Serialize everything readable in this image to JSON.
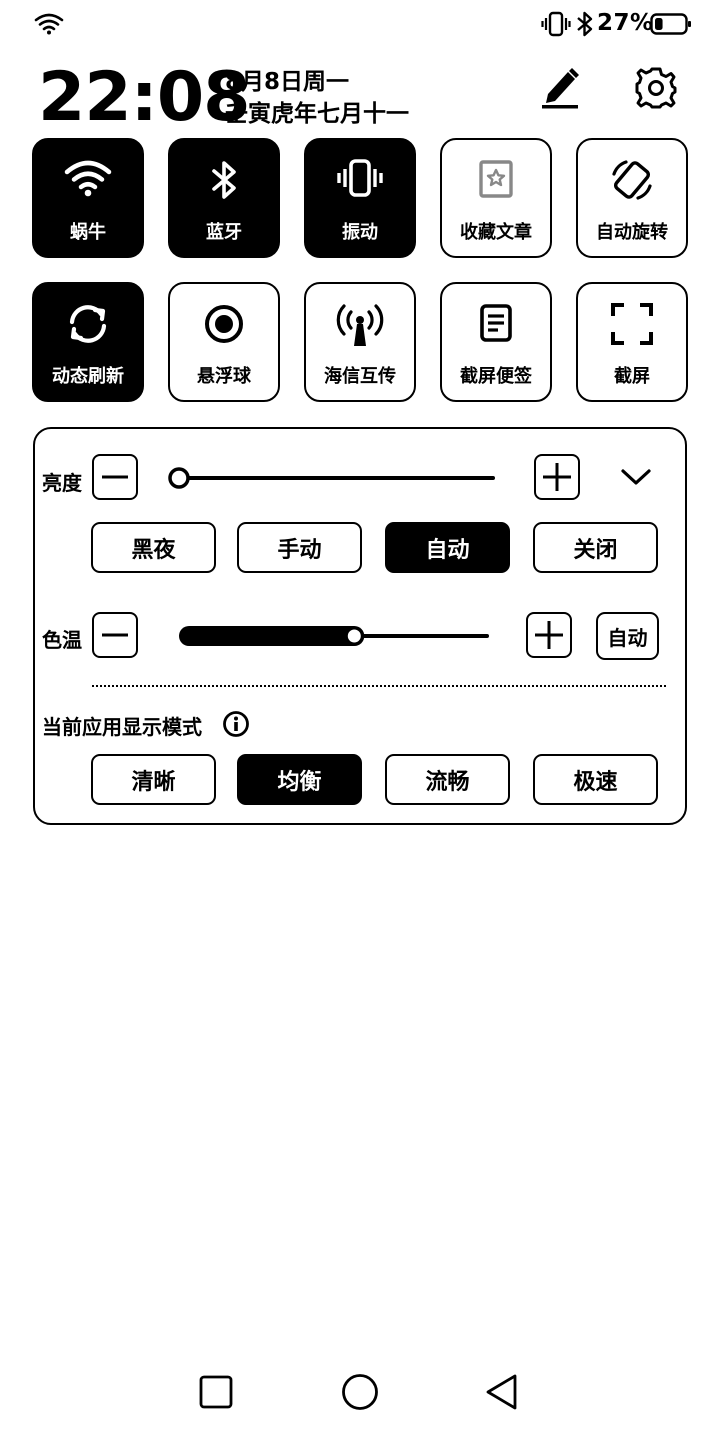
{
  "status_bar": {
    "battery_percent": "27%",
    "battery_level": 0.27,
    "icons": [
      "wifi-icon",
      "vibrate-icon",
      "bluetooth-icon",
      "battery-icon"
    ]
  },
  "header": {
    "time": "22:08",
    "date": "8月8日周一",
    "lunar_date": "壬寅虎年七月十一",
    "icons": [
      "edit-icon",
      "settings-icon"
    ]
  },
  "tiles": [
    {
      "label": "蜗牛",
      "icon": "wifi-icon",
      "active": true
    },
    {
      "label": "蓝牙",
      "icon": "bluetooth-icon",
      "active": true
    },
    {
      "label": "振动",
      "icon": "vibrate-icon",
      "active": true
    },
    {
      "label": "收藏文章",
      "icon": "bookmark-star-icon",
      "active": false
    },
    {
      "label": "自动旋转",
      "icon": "auto-rotate-icon",
      "active": false
    },
    {
      "label": "动态刷新",
      "icon": "refresh-icon",
      "active": true
    },
    {
      "label": "悬浮球",
      "icon": "floating-ball-icon",
      "active": false
    },
    {
      "label": "海信互传",
      "icon": "antenna-icon",
      "active": false
    },
    {
      "label": "截屏便签",
      "icon": "note-icon",
      "active": false
    },
    {
      "label": "截屏",
      "icon": "screenshot-icon",
      "active": false
    }
  ],
  "brightness": {
    "label": "亮度",
    "level": 0.0,
    "modes": [
      "黑夜",
      "手动",
      "自动",
      "关闭"
    ],
    "selected_mode": "自动"
  },
  "color_temp": {
    "label": "色温",
    "level": 0.57,
    "auto_label": "自动"
  },
  "display_mode": {
    "label": "当前应用显示模式",
    "modes": [
      "清晰",
      "均衡",
      "流畅",
      "极速"
    ],
    "selected_mode": "均衡"
  },
  "nav_bar": {
    "icons": [
      "recents-icon",
      "home-icon",
      "back-icon"
    ]
  }
}
